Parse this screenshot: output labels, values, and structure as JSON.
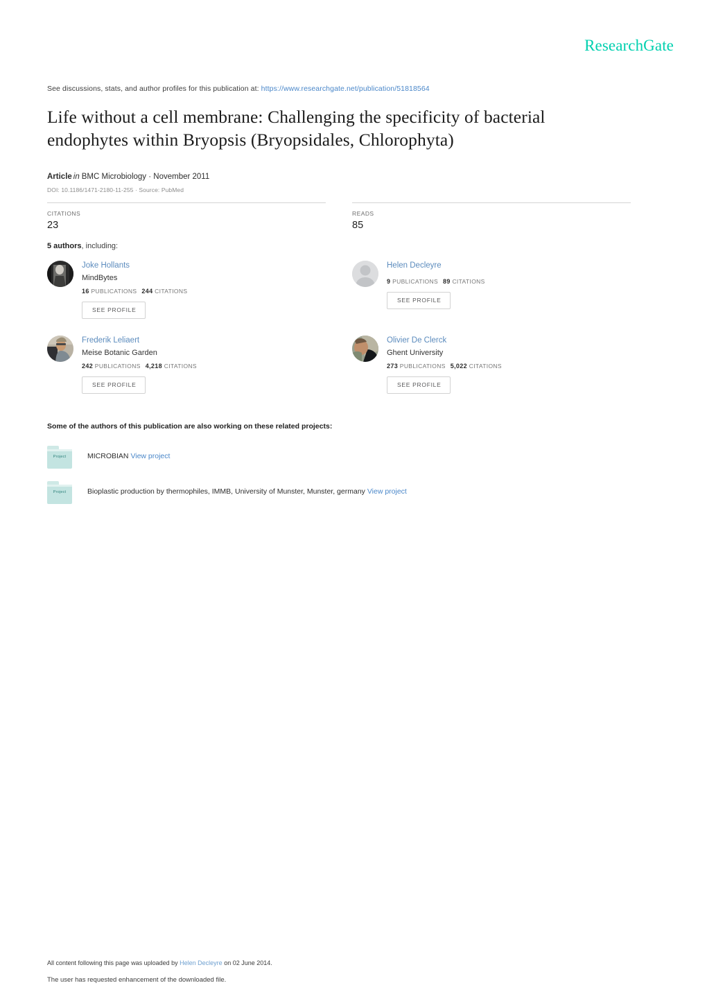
{
  "header": {
    "logo": "ResearchGate",
    "logo_color": "#00d0af",
    "discussion_prefix": "See discussions, stats, and author profiles for this publication at:",
    "discussion_url": "https://www.researchgate.net/publication/51818564"
  },
  "publication": {
    "title": "Life without a cell membrane: Challenging the specificity of bacterial endophytes within Bryopsis (Bryopsidales, Chlorophyta)",
    "type_label": "Article",
    "in_word": "in",
    "venue": "BMC Microbiology · November 2011",
    "doi_line": "DOI: 10.1186/1471-2180-11-255 · Source: PubMed"
  },
  "stats": [
    {
      "label": "CITATIONS",
      "value": "23"
    },
    {
      "label": "READS",
      "value": "85"
    }
  ],
  "authors_section": {
    "count_label": "5 authors",
    "including_label": ", including:",
    "see_profile_label": "SEE PROFILE",
    "publications_word": "PUBLICATIONS",
    "citations_word": "CITATIONS",
    "authors": [
      {
        "name": "Joke Hollants",
        "institution": "MindBytes",
        "publications": "16",
        "citations": "244",
        "avatar": "photo-dark"
      },
      {
        "name": "Helen Decleyre",
        "institution": "",
        "publications": "9",
        "citations": "89",
        "avatar": "placeholder-person"
      },
      {
        "name": "Frederik Leliaert",
        "institution": "Meise Botanic Garden",
        "publications": "242",
        "citations": "4,218",
        "avatar": "photo-light"
      },
      {
        "name": "Olivier De Clerck",
        "institution": "Ghent University",
        "publications": "273",
        "citations": "5,022",
        "avatar": "photo-medium"
      }
    ]
  },
  "projects_section": {
    "heading": "Some of the authors of this publication are also working on these related projects:",
    "folder_label": "Project",
    "view_project_label": "View project",
    "projects": [
      {
        "title": "MICROBIAN"
      },
      {
        "title": "Bioplastic production by thermophiles, IMMB, University of Munster, Munster, germany"
      }
    ]
  },
  "footer": {
    "upload_prefix": "All content following this page was uploaded by",
    "upload_author": "Helen Decleyre",
    "upload_suffix": "on 02 June 2014.",
    "enhancement_note": "The user has requested enhancement of the downloaded file."
  }
}
